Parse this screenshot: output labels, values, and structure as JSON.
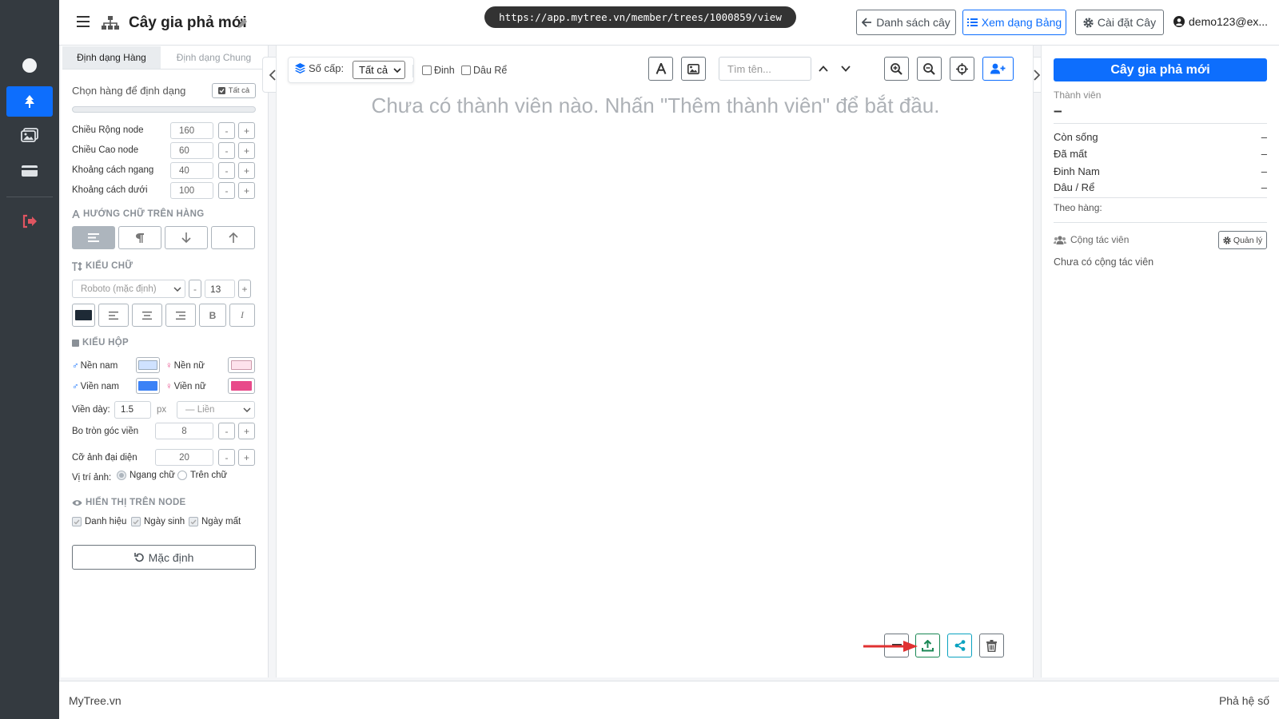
{
  "url": "https://app.mytree.vn/member/trees/1000859/view",
  "header": {
    "title": "Cây gia phả mới",
    "list_button": "Danh sách cây",
    "table_view_button": "Xem dạng Bảng",
    "settings_button": "Cài đặt Cây",
    "user": "demo123@ex..."
  },
  "left_panel": {
    "tabs": [
      "Định dạng Hàng",
      "Định dạng Chung"
    ],
    "select_row_label": "Chọn hàng để định dạng",
    "select_all_button": "Tất cả",
    "fields": [
      {
        "label": "Chiều Rộng node",
        "value": "160"
      },
      {
        "label": "Chiều Cao node",
        "value": "60"
      },
      {
        "label": "Khoảng cách ngang",
        "value": "40"
      },
      {
        "label": "Khoảng cách dưới",
        "value": "100"
      }
    ],
    "minus": "-",
    "plus": "+",
    "text_direction_title": "HƯỚNG CHỮ TRÊN HÀNG",
    "font_style_title": "KIỂU CHỮ",
    "font_family": "Roboto (mặc định)",
    "font_size": "13",
    "bold_label": "B",
    "italic_label": "I",
    "box_style_title": "KIỂU HỘP",
    "male_bg_label": "Nền nam",
    "female_bg_label": "Nền nữ",
    "male_border_label": "Viền nam",
    "female_border_label": "Viền nữ",
    "border_width_label": "Viền dày:",
    "border_width_value": "1.5",
    "border_width_unit": "px",
    "border_style_value": "— Liền",
    "corner_radius_label": "Bo tròn góc viền",
    "corner_radius_value": "8",
    "avatar_size_label": "Cỡ ảnh đại diện",
    "avatar_size_value": "20",
    "image_position_label": "Vị trí ảnh:",
    "image_position_options": [
      "Ngang chữ",
      "Trên chữ"
    ],
    "node_display_title": "HIỂN THỊ TRÊN NODE",
    "node_display_options": [
      "Danh hiệu",
      "Ngày sinh",
      "Ngày mất"
    ],
    "reset_button": "Mặc định"
  },
  "toolbar": {
    "level_label": "Số cấp:",
    "level_value": "Tất cả",
    "dinh_label": "Đinh",
    "dau_re_label": "Dâu Rể",
    "search_placeholder": "Tìm tên..."
  },
  "canvas": {
    "empty_message": "Chưa có thành viên nào. Nhấn \"Thêm thành viên\" để bắt đầu."
  },
  "right_panel": {
    "title_button": "Cây gia phả mới",
    "members_label": "Thành viên",
    "members_value": "–",
    "stats": [
      {
        "label": "Còn sống",
        "value": "–"
      },
      {
        "label": "Đã mất",
        "value": "–"
      },
      {
        "label": "Đinh Nam",
        "value": "–"
      },
      {
        "label": "Dâu / Rể",
        "value": "–"
      }
    ],
    "by_row_label": "Theo hàng:",
    "collaborators_label": "Cộng tác viên",
    "manage_button": "Quản lý",
    "no_collaborators": "Chưa có cộng tác viên"
  },
  "footer": {
    "left": "MyTree.vn",
    "right": "Phả hệ số"
  },
  "colors": {
    "primary": "#0d6efd",
    "sidebar": "#343a40",
    "danger": "#dc3545",
    "success": "#198754",
    "info": "#0dcaf0",
    "male_bg": "#cfe2ff",
    "female_bg": "#fde2ec",
    "male_border": "#3b82f6",
    "female_border": "#e84a8a",
    "text_color": "#1e2a36"
  }
}
